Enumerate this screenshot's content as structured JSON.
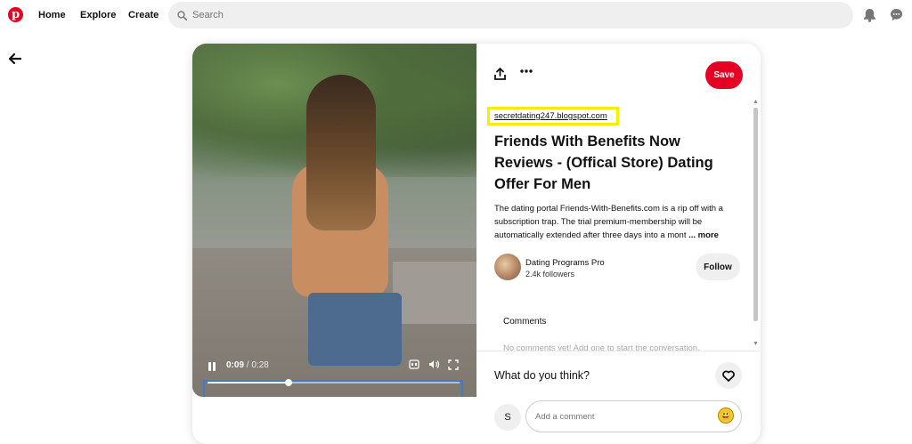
{
  "nav": {
    "logo_glyph": "p",
    "home_label": "Home",
    "explore_label": "Explore",
    "create_label": "Create",
    "search_placeholder": "Search",
    "brand_color": "#e60023"
  },
  "video": {
    "current_time": "0:09",
    "duration": "/ 0:28",
    "progress_fraction": 0.32,
    "state": "playing"
  },
  "pin": {
    "save_label": "Save",
    "source_link": "secretdating247.blogspot.com",
    "title": "Friends With Benefits Now Reviews - (Offical Store) Dating Offer For Men",
    "description": "The dating portal Friends-With-Benefits.com is a rip off with a subscription trap. The trial premium-membership will be automatically extended after three days into a mont",
    "more_label": "... more",
    "creator_name": "Dating Programs Pro",
    "followers": "2.4k followers",
    "follow_label": "Follow",
    "comments_heading": "Comments",
    "comments_truncated": "No comments yet! Add one to start the conversation."
  },
  "comment_box": {
    "prompt": "What do you think?",
    "user_initial": "S",
    "placeholder": "Add a comment",
    "emoji": "😃"
  }
}
